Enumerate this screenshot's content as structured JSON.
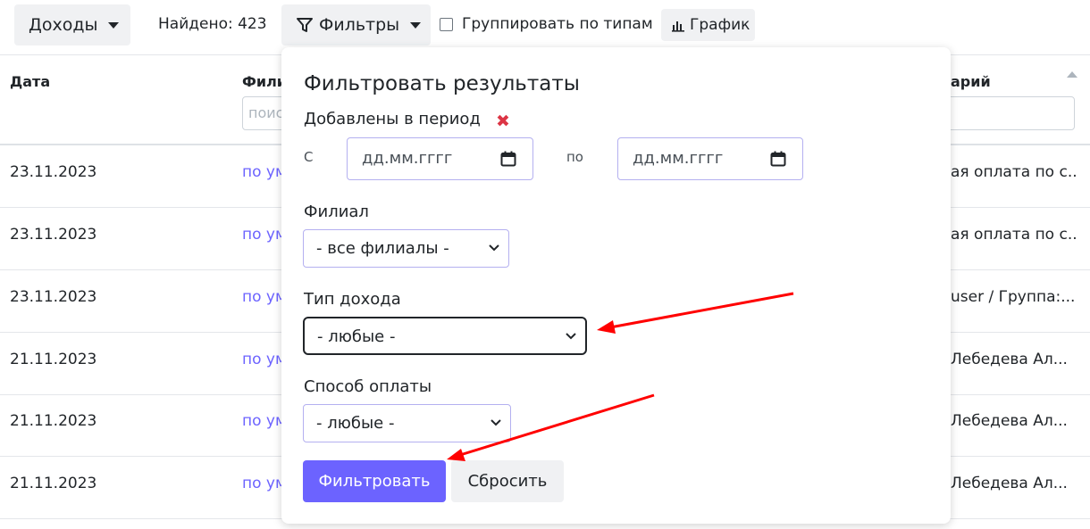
{
  "toolbar": {
    "income_label": "Доходы",
    "found_text": "Найдено: 423",
    "filters_label": "Фильтры",
    "group_label": "Группировать по типам",
    "chart_label": "График"
  },
  "table": {
    "headers": {
      "date": "Дата",
      "branch": "Фили",
      "comment": "арий"
    },
    "branch_placeholder": "поис",
    "rows": [
      {
        "date": "23.11.2023",
        "branch": "по ум",
        "comment": "ая оплата по с..."
      },
      {
        "date": "23.11.2023",
        "branch": "по ум",
        "comment": "ая оплата по с..."
      },
      {
        "date": "23.11.2023",
        "branch": "по ум",
        "comment": " user / Группа:..."
      },
      {
        "date": "21.11.2023",
        "branch": "по ум",
        "comment": " Лебедева Ал..."
      },
      {
        "date": "21.11.2023",
        "branch": "по ум",
        "comment": " Лебедева Ал..."
      },
      {
        "date": "21.11.2023",
        "branch": "по ум",
        "comment": " Лебедева Ал..."
      }
    ]
  },
  "filter_popover": {
    "title": "Фильтровать результаты",
    "period_label": "Добавлены в период",
    "remove_icon": "✖",
    "from_label": "С",
    "to_label": "по",
    "date_placeholder": "дд.мм.гггг",
    "branch_label": "Филиал",
    "branch_value": "- все филиалы -",
    "income_type_label": "Тип дохода",
    "income_type_value": "- любые -",
    "payment_label": "Способ оплаты",
    "payment_value": "- любые -",
    "submit_label": "Фильтровать",
    "reset_label": "Сбросить"
  },
  "colors": {
    "accent": "#6c63ff",
    "remove_red": "#dc3545",
    "annotation_arrow": "#ff0000"
  }
}
